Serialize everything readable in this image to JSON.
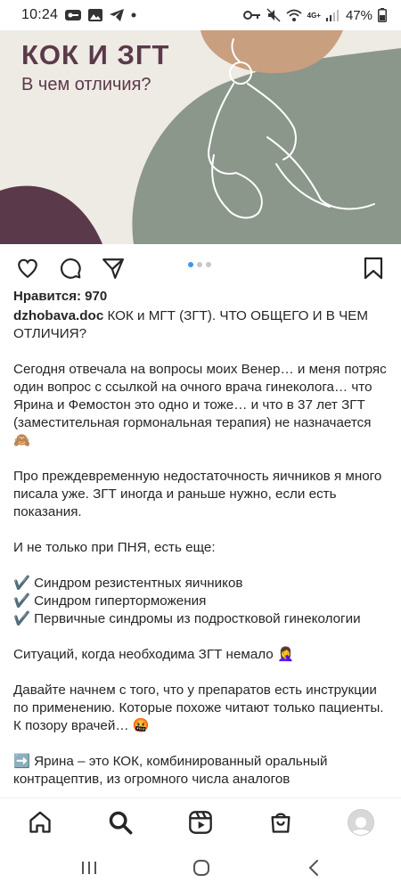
{
  "status_bar": {
    "time": "10:24",
    "battery": "47%",
    "network": "4G+"
  },
  "post": {
    "image_title": "КОК И ЗГТ",
    "image_subtitle": "В чем отличия?",
    "carousel": {
      "count": 3,
      "active": 0
    },
    "likes": "Нравится: 970",
    "username": "dzhobava.doc",
    "caption_first": " КОК и МГТ (ЗГТ). ЧТО ОБЩЕГО И В ЧЕМ ОТЛИЧИЯ?",
    "paragraphs": [
      "Сегодня отвечала на вопросы моих Венер… и меня потряс один вопрос с ссылкой на очного врача гинеколога… что Ярина и Фемостон это одно и тоже… и что в 37 лет ЗГТ (заместительная гормональная терапия) не назначается 🙈",
      "Про преждевременную недостаточность яичников я много писала уже. ЗГТ иногда и раньше нужно, если есть показания.",
      "И не только при ПНЯ, есть еще:",
      "✔️ Синдром резистентных яичников",
      "✔️ Синдром гиперторможения",
      "✔️ Первичные синдромы из подростковой гинекологии",
      "Ситуаций, когда необходима ЗГТ немало 🤦‍♀️",
      "Давайте начнем с того, что у препаратов есть инструкции по применению. Которые похоже читают только пациенты. К позору врачей… 🤬",
      "➡️ Ярина – это КОК, комбинированный оральный контрацептив, из огромного числа аналогов"
    ]
  },
  "icons": {
    "like": "heart-icon",
    "comment": "comment-icon",
    "share": "send-icon",
    "save": "bookmark-icon",
    "home": "home-icon",
    "search": "search-icon",
    "reels": "reels-icon",
    "shop": "shop-icon",
    "profile": "avatar"
  },
  "colors": {
    "accent": "#3897f0",
    "image_green": "#8a978a",
    "image_peach": "#c89f7f",
    "image_plum": "#5a3a4a"
  }
}
